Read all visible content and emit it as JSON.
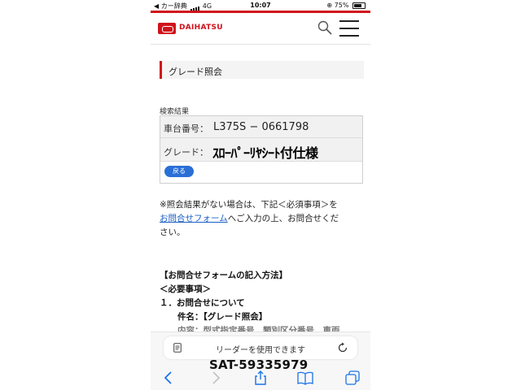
{
  "status_bar": {
    "carrier": "◀ カー辞典",
    "network": "4G",
    "time": "10:07",
    "battery_text": "75%",
    "battery_level": 0.75
  },
  "header": {
    "brand": "DAIHATSU"
  },
  "section": {
    "heading": "グレード照会"
  },
  "result": {
    "label": "検索結果",
    "vin_label": "車台番号：",
    "vin_value": "L375S − 0661798",
    "grade_label": "グレード：",
    "grade_value": "ｽﾛｰﾊﾟｰﾘﾔｼｰﾄ付仕様",
    "back_button": "戻る"
  },
  "notice": {
    "line1": "※照会結果がない場合は、下記＜必須事項＞を",
    "link": "お問合せフォーム",
    "line2_rest": "へご入力の上、お問合せくだ",
    "line3": "さい。"
  },
  "instructions": {
    "title": "【お問合せフォームの記入方法】",
    "required": "＜必要事項＞",
    "item1": "１．お問合せについて",
    "subject_line": "件名：【グレード照会】",
    "content_line": "内容：型式指定番号　類別区分番号　車両"
  },
  "browser": {
    "reader_text": "リーダーを使用できます",
    "watermark": "SAT-59335979"
  },
  "colors": {
    "brand_red": "#d0121b",
    "link_blue": "#1a5fc4",
    "button_blue": "#2a6fd6",
    "ios_blue": "#1a73e8"
  }
}
